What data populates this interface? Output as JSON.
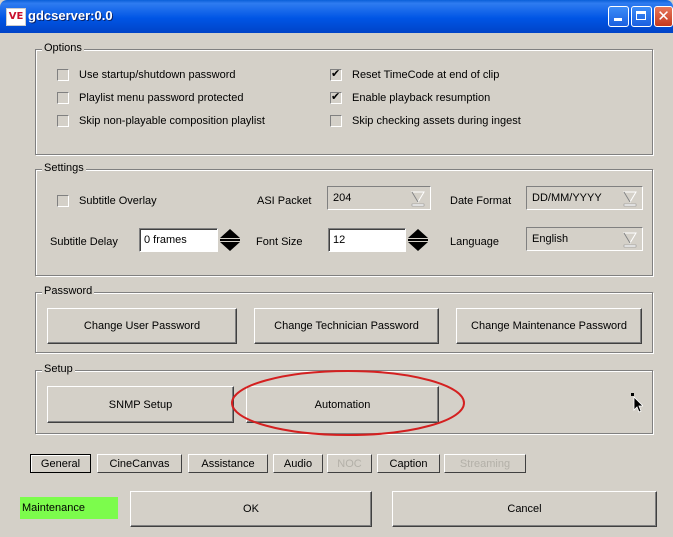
{
  "window": {
    "title": "gdcserver:0.0",
    "icon": "app-logo-icon"
  },
  "options": {
    "legend": "Options",
    "items": [
      {
        "label": "Use startup/shutdown password",
        "checked": false
      },
      {
        "label": "Playlist menu password protected",
        "checked": false
      },
      {
        "label": "Skip non-playable composition playlist",
        "checked": false
      },
      {
        "label": "Reset TimeCode at end of clip",
        "checked": true
      },
      {
        "label": "Enable playback resumption",
        "checked": true
      },
      {
        "label": "Skip checking assets during ingest",
        "checked": false
      }
    ]
  },
  "settings": {
    "legend": "Settings",
    "subtitle_overlay": {
      "label": "Subtitle Overlay",
      "checked": false
    },
    "asi_packet": {
      "label": "ASI Packet",
      "value": "204"
    },
    "date_format": {
      "label": "Date Format",
      "value": "DD/MM/YYYY"
    },
    "subtitle_delay": {
      "label": "Subtitle Delay",
      "value": "0  frames"
    },
    "font_size": {
      "label": "Font Size",
      "value": "12"
    },
    "language": {
      "label": "Language",
      "value": "English"
    }
  },
  "password": {
    "legend": "Password",
    "buttons": [
      "Change User Password",
      "Change Technician Password",
      "Change Maintenance Password"
    ]
  },
  "setup": {
    "legend": "Setup",
    "buttons": [
      "SNMP Setup",
      "Automation"
    ]
  },
  "tabs": [
    {
      "label": "General",
      "active": true,
      "enabled": true
    },
    {
      "label": "CineCanvas",
      "active": false,
      "enabled": true
    },
    {
      "label": "Assistance",
      "active": false,
      "enabled": true
    },
    {
      "label": "Audio",
      "active": false,
      "enabled": true
    },
    {
      "label": "NOC",
      "active": false,
      "enabled": false
    },
    {
      "label": "Caption",
      "active": false,
      "enabled": true
    },
    {
      "label": "Streaming",
      "active": false,
      "enabled": false
    }
  ],
  "footer": {
    "status": "Maintenance",
    "status_color": "#7cfc4c",
    "ok_label": "OK",
    "cancel_label": "Cancel"
  },
  "annotation_color": "#d42020"
}
